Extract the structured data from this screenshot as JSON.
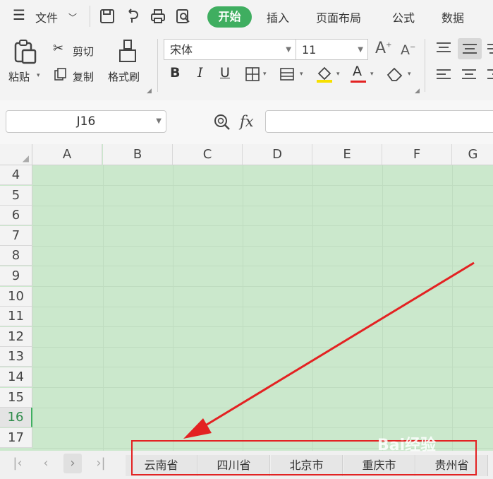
{
  "menu": {
    "file": "文件",
    "tabs": [
      "开始",
      "插入",
      "页面布局",
      "公式",
      "数据"
    ]
  },
  "clipboard": {
    "paste": "粘贴",
    "cut": "剪切",
    "copy": "复制",
    "format_painter": "格式刷"
  },
  "font": {
    "name": "宋体",
    "size": "11",
    "bold": "B",
    "italic": "I",
    "underline": "U",
    "font_color": "A"
  },
  "formula_bar": {
    "cell_ref": "J16",
    "fx": "fx"
  },
  "grid": {
    "columns": [
      "A",
      "B",
      "C",
      "D",
      "E",
      "F",
      "G"
    ],
    "rows": [
      "4",
      "5",
      "6",
      "7",
      "8",
      "9",
      "10",
      "11",
      "12",
      "13",
      "14",
      "15",
      "16",
      "17"
    ],
    "active_row": "16"
  },
  "sheets": [
    "云南省",
    "四川省",
    "北京市",
    "重庆市",
    "贵州省"
  ],
  "colors": {
    "accent": "#3fae60",
    "annotation": "#e32222",
    "sheet_bg": "#cbe8cc"
  },
  "watermark": "Bai经验"
}
